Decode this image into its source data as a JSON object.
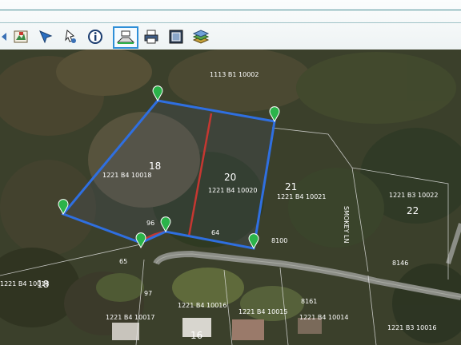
{
  "toolbar": {
    "tools": [
      {
        "name": "prev-arrow-icon"
      },
      {
        "name": "map-layers-icon"
      },
      {
        "name": "select-arrow-icon"
      },
      {
        "name": "pan-cursor-icon"
      },
      {
        "name": "info-icon"
      },
      {
        "name": "measure-plot-icon",
        "active": true
      },
      {
        "name": "print-icon"
      },
      {
        "name": "overview-frame-icon"
      },
      {
        "name": "stack-layers-icon"
      }
    ]
  },
  "map": {
    "parcels": {
      "p18": {
        "number": "18",
        "id": "1221 B4 10018"
      },
      "p20": {
        "number": "20",
        "id": "1221 B4 10020"
      },
      "p21": {
        "number": "21",
        "id": "1221 B4 10021"
      },
      "p22": {
        "number": "22",
        "id": "1221 B3 10022"
      },
      "p16": {
        "number": "16",
        "id": "1221 B4 10016"
      },
      "top": {
        "id": "1113 B1 10002"
      },
      "left18": {
        "number": "18",
        "id": "1221 B4 10018"
      },
      "b17": {
        "id": "1221 B4 10017"
      },
      "b15": {
        "id": "1221 B4 10015"
      },
      "b14": {
        "id": "1221 B4 10014"
      },
      "b16b": {
        "id": "1221 B3 10016"
      }
    },
    "street_name": "SMOKEY LN",
    "addresses": [
      "96",
      "64",
      "8100",
      "8161",
      "8146",
      "97",
      "65"
    ],
    "colors": {
      "boundary": "#2f6fe0",
      "split_line": "#e03020",
      "marker": "#2bb34a"
    }
  }
}
